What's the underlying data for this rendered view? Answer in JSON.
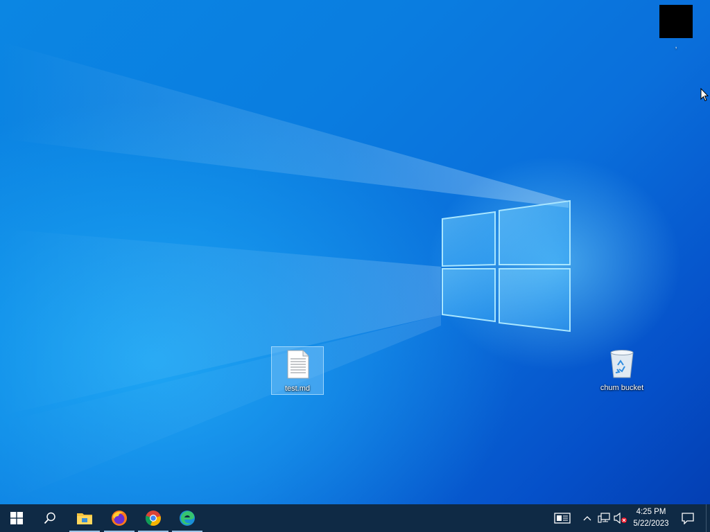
{
  "desktop": {
    "icons": [
      {
        "name": "test-md-file",
        "label": "test.md",
        "selected": true
      },
      {
        "name": "recycle-bin",
        "label": "chum bucket",
        "selected": false
      }
    ],
    "top_right_item": {
      "label": ","
    }
  },
  "taskbar": {
    "buttons": [
      {
        "icon": "windows-start-icon"
      },
      {
        "icon": "search-icon"
      },
      {
        "icon": "file-explorer-icon",
        "running": true
      },
      {
        "icon": "firefox-icon",
        "running": true
      },
      {
        "icon": "chrome-icon",
        "running": true
      },
      {
        "icon": "edge-icon",
        "running": true
      }
    ],
    "tray": {
      "icons": [
        "news-widget-icon",
        "chevron-up-icon",
        "network-icon",
        "volume-muted-icon"
      ],
      "time": "4:25 PM",
      "date": "5/22/2023",
      "notification_icon": "action-center-icon"
    }
  },
  "colors": {
    "taskbar_bg": "#0f2a45",
    "wallpaper_blue": "#0a7de0",
    "selection": "#96d2ff"
  }
}
